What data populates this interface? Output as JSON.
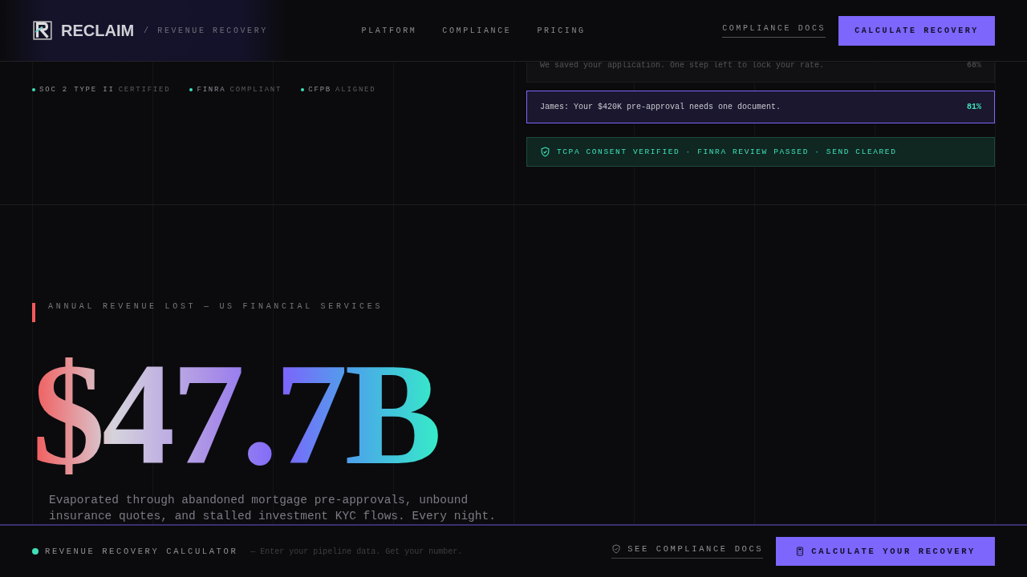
{
  "header": {
    "brand": "RECLAIM",
    "tagline": "/ REVENUE RECOVERY",
    "nav": [
      "PLATFORM",
      "COMPLIANCE",
      "PRICING"
    ],
    "docs_link": "COMPLIANCE DOCS",
    "cta": "CALCULATE RECOVERY"
  },
  "badges": [
    {
      "label": "SOC 2 TYPE II",
      "status": "CERTIFIED"
    },
    {
      "label": "FINRA",
      "status": "COMPLIANT"
    },
    {
      "label": "CFPB",
      "status": "ALIGNED"
    }
  ],
  "messages": [
    {
      "text": "We saved your application. One step left to lock your rate.",
      "score": "68%",
      "selected": false
    },
    {
      "text": "James: Your $420K pre-approval needs one document.",
      "score": "81%",
      "selected": true
    }
  ],
  "verification": "TCPA CONSENT VERIFIED · FINRA REVIEW PASSED · SEND CLEARED",
  "hero": {
    "eyebrow": "ANNUAL REVENUE LOST — US FINANCIAL SERVICES",
    "figure": "$47.7B",
    "description": "Evaporated through abandoned mortgage pre-approvals, unbound insurance quotes, and stalled investment KYC flows. Every night."
  },
  "bottom_bar": {
    "title": "REVENUE RECOVERY CALCULATOR",
    "hint": "— Enter your pipeline data. Get your number.",
    "link": "SEE COMPLIANCE DOCS",
    "cta": "CALCULATE YOUR RECOVERY"
  }
}
